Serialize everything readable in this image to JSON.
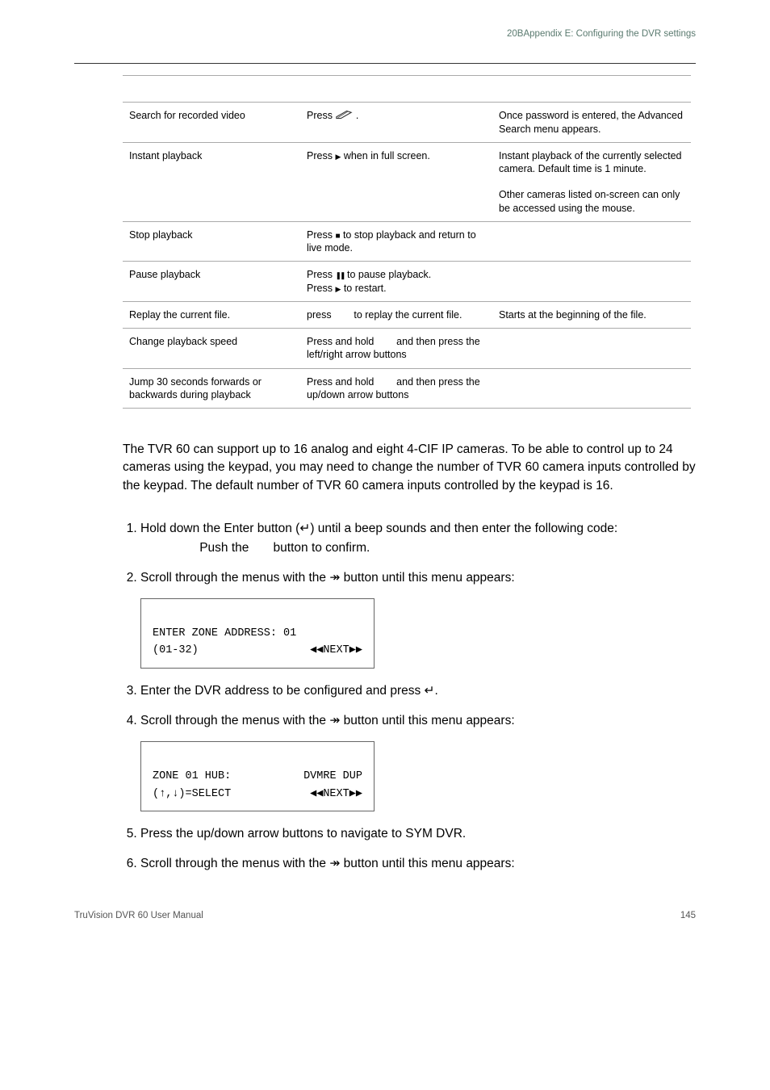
{
  "header": {
    "right_text": "20BAppendix E: Configuring the DVR settings"
  },
  "table": {
    "rows": [
      {
        "c1": "",
        "c2": "",
        "c3": ""
      },
      {
        "c1": "Search for recorded video",
        "c2_prefix": "Press",
        "c2_icon": "pencil",
        "c2_suffix": ".",
        "c3": "Once password is entered, the Advanced Search menu appears."
      },
      {
        "c1": "Instant playback",
        "c2_prefix": "Press ",
        "c2_sym": "▶",
        "c2_suffix": " when in full screen.",
        "c3": "Instant playback of the currently selected camera. Default time is 1 minute.",
        "c3b": "Other cameras listed on-screen can only be accessed using the mouse."
      },
      {
        "c1": "Stop playback",
        "c2_prefix": "Press ",
        "c2_sym": "■",
        "c2_suffix": " to stop playback and return to live mode.",
        "c3": ""
      },
      {
        "c1": "Pause playback",
        "c2_line1_prefix": "Press ",
        "c2_line1_sym": "❚❚",
        "c2_line1_suffix": " to pause playback.",
        "c2_line2_prefix": "Press ",
        "c2_line2_sym": "▶",
        "c2_line2_suffix": " to restart.",
        "c3": ""
      },
      {
        "c1": "Replay the current file.",
        "c2_prefix": "press ",
        "c2_mid": "",
        "c2_suffix": " to replay the current file.",
        "c3": "Starts at the beginning of the file."
      },
      {
        "c1": "Change playback speed",
        "c2_text": "Press and hold        and then press the left/right arrow buttons",
        "c3": ""
      },
      {
        "c1": "Jump 30 seconds forwards or backwards during playback",
        "c2_text": "Press and hold        and then press the up/down arrow buttons",
        "c3": ""
      }
    ]
  },
  "paragraph": "The TVR 60 can support up to 16 analog and eight 4-CIF IP cameras. To be able to control up to 24 cameras using the keypad, you may need to change the number of TVR 60 camera inputs controlled by the keypad. The default number of TVR 60 camera inputs controlled by the keypad is 16.",
  "steps": {
    "s1a": "Hold down the Enter button (",
    "s1_sym": "↵",
    "s1b": ")  until a beep sounds and then enter the following code:",
    "s1c": "                 Push the ",
    "s1d": "      button to confirm.",
    "s2a": "Scroll through the menus with the ",
    "s2_sym": "↠",
    "s2b": " button until this menu appears:",
    "lcd1_line1": "ENTER ZONE ADDRESS: 01",
    "lcd1_line2a": "(01-32)",
    "lcd1_line2b": "◀◀NEXT▶▶",
    "s3a": "Enter the DVR address to be configured and press ",
    "s3_sym": "↵",
    "s3b": ".",
    "s4a": "Scroll through the menus with the ",
    "s4_sym": "↠",
    "s4b": " button until this menu appears:",
    "lcd2_line1a": "ZONE 01 HUB:",
    "lcd2_line1b": "DVMRE DUP",
    "lcd2_line2a": "(↑,↓)=SELECT",
    "lcd2_line2b": "◀◀NEXT▶▶",
    "s5": "Press the up/down arrow buttons to navigate to SYM DVR.",
    "s6a": "Scroll through the menus with the ",
    "s6_sym": "↠",
    "s6b": " button until this menu appears:"
  },
  "footer": {
    "left": "TruVision DVR 60 User Manual",
    "right": "145"
  }
}
